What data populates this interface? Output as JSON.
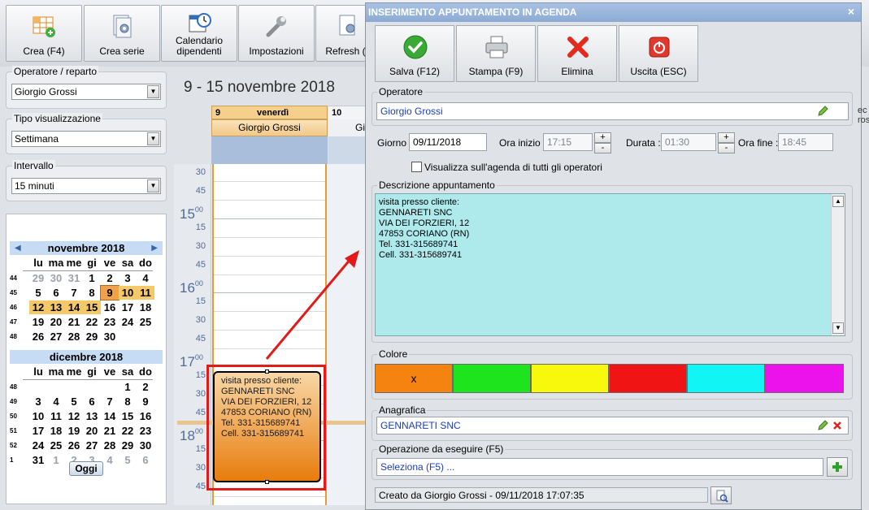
{
  "toolbar": {
    "buttons": [
      {
        "label": "Crea (F4)",
        "icon": "grid-add-icon"
      },
      {
        "label": "Crea serie",
        "icon": "doc-gear-icon"
      },
      {
        "label": "Calendario dipendenti",
        "icon": "calendar-clock-icon"
      },
      {
        "label": "Impostazioni",
        "icon": "wrench-icon"
      },
      {
        "label": "Refresh (",
        "icon": "doc-gear-icon"
      }
    ]
  },
  "left": {
    "operatore_label": "Operatore / reparto",
    "operatore_value": "Giorgio Grossi",
    "tipo_label": "Tipo visualizzazione",
    "tipo_value": "Settimana",
    "intervallo_label": "Intervallo",
    "intervallo_value": "15 minuti",
    "calendar": {
      "weekdays": [
        "lu",
        "ma",
        "me",
        "gi",
        "ve",
        "sa",
        "do"
      ],
      "nov": {
        "title": "novembre 2018",
        "weeks": [
          {
            "wk": "44",
            "days": [
              "29",
              "30",
              "31",
              "1",
              "2",
              "3",
              "4"
            ]
          },
          {
            "wk": "45",
            "days": [
              "5",
              "6",
              "7",
              "8",
              "9",
              "10",
              "11"
            ]
          },
          {
            "wk": "46",
            "days": [
              "12",
              "13",
              "14",
              "15",
              "16",
              "17",
              "18"
            ]
          },
          {
            "wk": "47",
            "days": [
              "19",
              "20",
              "21",
              "22",
              "23",
              "24",
              "25"
            ]
          },
          {
            "wk": "48",
            "days": [
              "26",
              "27",
              "28",
              "29",
              "30",
              "",
              ""
            ]
          }
        ]
      },
      "dec": {
        "title": "dicembre 2018",
        "weeks": [
          {
            "wk": "48",
            "days": [
              "",
              "",
              "",
              "",
              "",
              "1",
              "2"
            ]
          },
          {
            "wk": "49",
            "days": [
              "3",
              "4",
              "5",
              "6",
              "7",
              "8",
              "9"
            ]
          },
          {
            "wk": "50",
            "days": [
              "10",
              "11",
              "12",
              "13",
              "14",
              "15",
              "16"
            ]
          },
          {
            "wk": "51",
            "days": [
              "17",
              "18",
              "19",
              "20",
              "21",
              "22",
              "23"
            ]
          },
          {
            "wk": "52",
            "days": [
              "24",
              "25",
              "26",
              "27",
              "28",
              "29",
              "30"
            ]
          },
          {
            "wk": "1",
            "days": [
              "31",
              "1",
              "2",
              "3",
              "4",
              "5",
              "6"
            ]
          }
        ]
      },
      "oggi_label": "Oggi"
    }
  },
  "agenda": {
    "week_title": "9 - 15 novembre 2018",
    "day_num": "9",
    "day_name": "venerdì",
    "next_day_num": "10",
    "operator": "Giorgio Grossi",
    "next_operator_peek": "Gi",
    "time_labels": {
      "a30": "30",
      "a45": "45",
      "h15": "15",
      "h15_15": "15",
      "h15_30": "30",
      "h15_45": "45",
      "h16": "16",
      "h16_15": "15",
      "h16_30": "30",
      "h16_45": "45",
      "h17": "17",
      "h17_15": "15",
      "h17_30": "30",
      "h17_45": "45",
      "h18": "18",
      "h18_15": "15",
      "h18_30": "30",
      "h18_45": "45",
      "sup": "00"
    },
    "appointment_lines": [
      "visita presso cliente:",
      "GENNARETI SNC",
      "VIA DEI FORZIERI, 12",
      "47853 CORIANO (RN)",
      "Tel. 331-315689741",
      "Cell. 331-315689741"
    ]
  },
  "dialog": {
    "title": "INSERIMENTO APPUNTAMENTO IN AGENDA",
    "close": "×",
    "buttons": [
      {
        "label": "Salva (F12)",
        "icon": "check-icon"
      },
      {
        "label": "Stampa (F9)",
        "icon": "printer-icon"
      },
      {
        "label": "Elimina",
        "icon": "x-mark-icon"
      },
      {
        "label": "Uscita (ESC)",
        "icon": "power-icon"
      }
    ],
    "operatore_label": "Operatore",
    "operatore_value": "Giorgio Grossi",
    "giorno_label": "Giorno :",
    "giorno_value": "09/11/2018",
    "ora_inizio_label": "Ora inizio :",
    "ora_inizio_value": "17:15",
    "durata_label": "Durata :",
    "durata_value": "01:30",
    "ora_fine_label": "Ora fine :",
    "ora_fine_value": "18:45",
    "spin_plus": "+",
    "spin_minus": "-",
    "visualizza_label": "Visualizza sull'agenda di tutti gli operatori",
    "descrizione_label": "Descrizione appuntamento",
    "descrizione_lines": [
      "visita presso cliente:",
      "GENNARETI SNC",
      "VIA DEI FORZIERI, 12",
      "47853 CORIANO (RN)",
      "Tel. 331-315689741",
      "Cell. 331-315689741"
    ],
    "colore_label": "Colore",
    "colors": [
      "#f58310",
      "#1de41d",
      "#f8f80d",
      "#f01414",
      "#12f5f5",
      "#ec12ec"
    ],
    "selected_color_mark": "x",
    "anagrafica_label": "Anagrafica",
    "anagrafica_value": "GENNARETI SNC",
    "operazione_label": "Operazione da eseguire (F5)",
    "operazione_value": "Seleziona (F5) ...",
    "status": "Creato da Giorgio Grossi - 09/11/2018 17:07:35"
  },
  "peek": {
    "right_a": "ec",
    "right_b": "ros"
  }
}
